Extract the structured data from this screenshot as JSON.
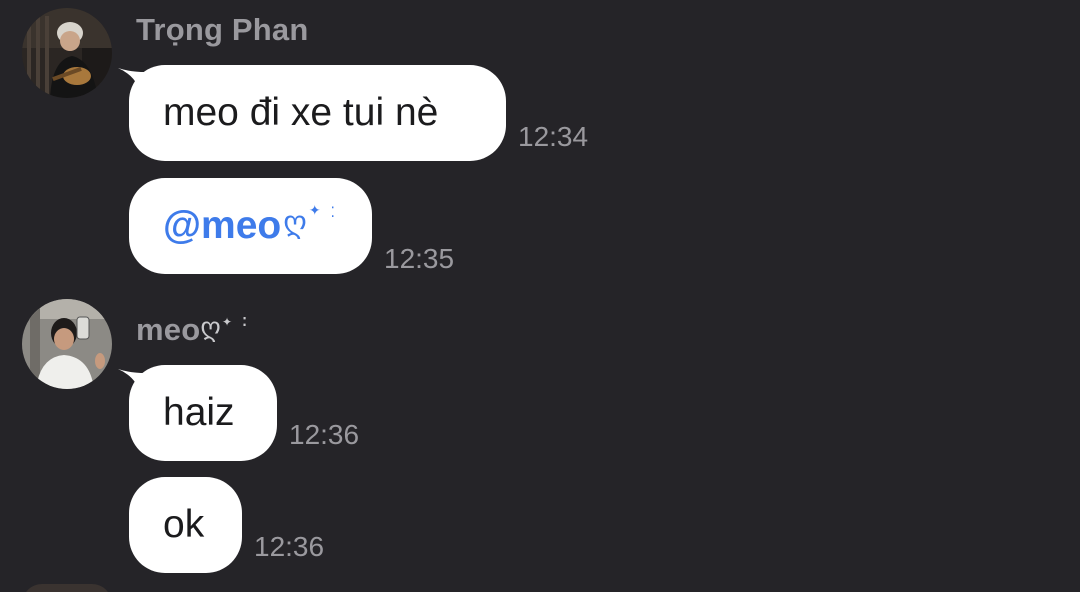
{
  "messages": [
    {
      "sender": "Trọng Phan",
      "bubbles": [
        {
          "text": "meo đi xe tui nè",
          "time": "12:34"
        },
        {
          "mention": "@meo",
          "time": "12:35"
        }
      ]
    },
    {
      "sender": "meo",
      "bubbles": [
        {
          "text": "haiz",
          "time": "12:36"
        },
        {
          "text": "ok",
          "time": "12:36"
        }
      ]
    }
  ],
  "colors": {
    "background": "#252428",
    "bubble": "#ffffff",
    "mention": "#3e7bea",
    "muted": "#9a999e"
  },
  "icons": {
    "avatar1": "avatar-guitar-photo",
    "avatar2": "avatar-mirror-selfie-photo",
    "decoration": "swirl-sparkle-decoration"
  }
}
